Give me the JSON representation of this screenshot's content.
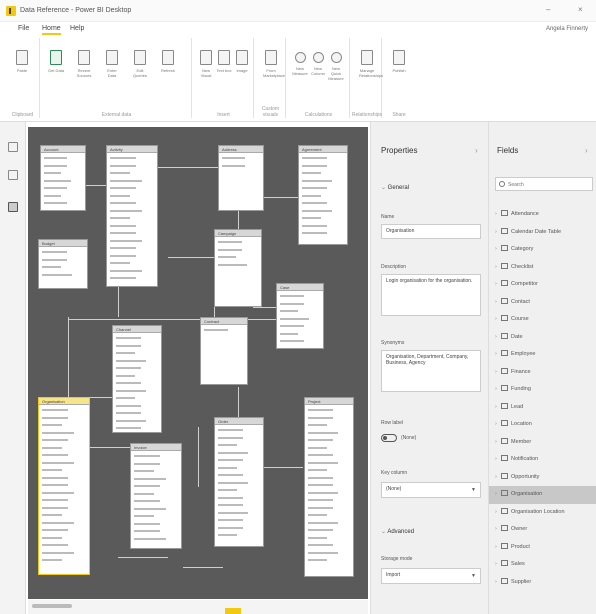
{
  "window": {
    "title": "Data Reference - Power BI Desktop",
    "minimize": "–",
    "close": "×",
    "user": "Angela Finnerty"
  },
  "menu": {
    "items": [
      "File",
      "Home",
      "Help"
    ],
    "active_index": 1
  },
  "ribbon": {
    "groups": [
      {
        "label": "Clipboard",
        "buttons": [
          "Paste"
        ]
      },
      {
        "label": "External data",
        "buttons": [
          "Get Data",
          "Recent Sources",
          "Enter Data",
          "Edit Queries",
          "Refresh"
        ]
      },
      {
        "label": "Insert",
        "buttons": [
          "New Visual",
          "Text box",
          "Image"
        ]
      },
      {
        "label": "Custom visuals",
        "buttons": [
          "From Marketplace"
        ]
      },
      {
        "label": "Calculations",
        "buttons": [
          "New Measure",
          "New Column",
          "New Quick Measure"
        ]
      },
      {
        "label": "Relationships",
        "buttons": [
          "Manage Relationships"
        ]
      },
      {
        "label": "Share",
        "buttons": [
          "Publish"
        ]
      }
    ]
  },
  "properties": {
    "title": "Properties",
    "collapse": "›",
    "general_label": "General",
    "name_label": "Name",
    "name_value": "Organisation",
    "description_label": "Description",
    "description_value": "Login organisation for the organisation.",
    "synonyms_label": "Synonyms",
    "synonyms_value": "Organisation, Department, Company, Business, Agency",
    "row_label_label": "Row label",
    "row_label_value": "(None)",
    "key_column_label": "Key column",
    "key_column_value": "(None)",
    "storage_label": "Advanced",
    "storage_mode_label": "Storage mode",
    "storage_mode_value": "Import"
  },
  "fields": {
    "title": "Fields",
    "collapse": "›",
    "search_placeholder": "Search",
    "items": [
      "Attendance",
      "Calendar Date Table",
      "Category",
      "Checklist",
      "Competitor",
      "Contact",
      "Course",
      "Date",
      "Employee",
      "Finance",
      "Funding",
      "Lead",
      "Location",
      "Member",
      "Notification",
      "Opportunity",
      "Organisation",
      "Organisation Location",
      "Owner",
      "Product",
      "Sales",
      "Supplier"
    ],
    "selected_index": 16
  },
  "canvas": {
    "tables": [
      "Account",
      "Activity",
      "Address",
      "Agreement",
      "Budget",
      "Campaign",
      "Case",
      "Channel",
      "Contract",
      "Organisation",
      "Invoice",
      "Order",
      "Project",
      "Quote",
      "Region",
      "Transaction"
    ]
  }
}
